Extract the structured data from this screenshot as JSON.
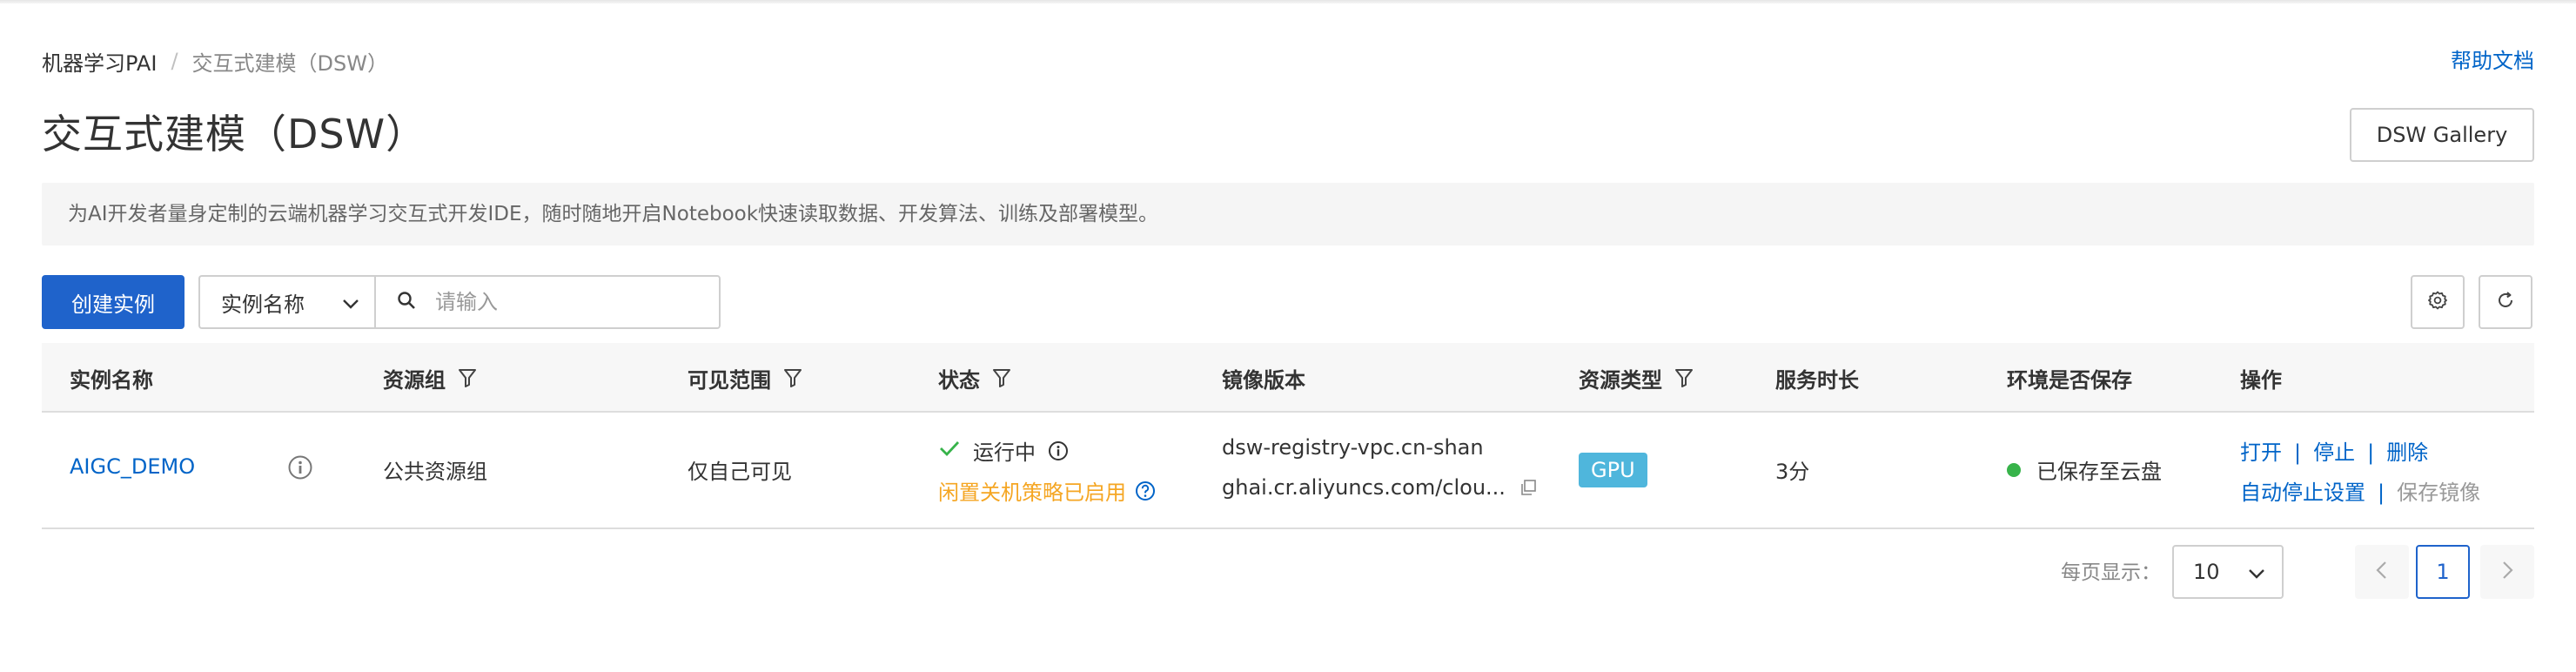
{
  "breadcrumb": {
    "root": "机器学习PAI",
    "separator": "/",
    "current": "交互式建模（DSW）"
  },
  "help_link": "帮助文档",
  "page_title": "交互式建模（DSW）",
  "gallery_button": "DSW Gallery",
  "description": "为AI开发者量身定制的云端机器学习交互式开发IDE，随时随地开启Notebook快速读取数据、开发算法、训练及部署模型。",
  "toolbar": {
    "create_label": "创建实例",
    "filter_field": "实例名称",
    "search_placeholder": "请输入"
  },
  "table": {
    "columns": [
      {
        "label": "实例名称",
        "filterable": false
      },
      {
        "label": "资源组",
        "filterable": true
      },
      {
        "label": "可见范围",
        "filterable": true
      },
      {
        "label": "状态",
        "filterable": true
      },
      {
        "label": "镜像版本",
        "filterable": false
      },
      {
        "label": "资源类型",
        "filterable": true
      },
      {
        "label": "服务时长",
        "filterable": false
      },
      {
        "label": "环境是否保存",
        "filterable": false
      },
      {
        "label": "操作",
        "filterable": false
      }
    ],
    "rows": [
      {
        "name": "AIGC_DEMO",
        "resource_group": "公共资源组",
        "visibility": "仅自己可见",
        "status": "运行中",
        "status_note": "闲置关机策略已启用",
        "image_line1": "dsw-registry-vpc.cn-shan",
        "image_line2": "ghai.cr.aliyuncs.com/clou...",
        "resource_type": "GPU",
        "duration": "3分",
        "env_saved": "已保存至云盘",
        "actions": {
          "open": "打开",
          "stop": "停止",
          "delete": "删除",
          "auto_stop": "自动停止设置",
          "save_image": "保存镜像"
        }
      }
    ]
  },
  "pagination": {
    "per_page_label": "每页显示：",
    "per_page": "10",
    "current_page": "1"
  },
  "colors": {
    "primary": "#1f63cb",
    "link": "#0064c8",
    "running": "#37b34a",
    "warning": "#f5a623",
    "gpu_badge": "#4fb6dc"
  },
  "icons": [
    "search-icon",
    "chevron-down-icon",
    "filter-icon",
    "info-icon",
    "check-icon",
    "help-circle-icon",
    "copy-icon",
    "gear-icon",
    "refresh-icon",
    "chevron-left-icon",
    "chevron-right-icon"
  ]
}
